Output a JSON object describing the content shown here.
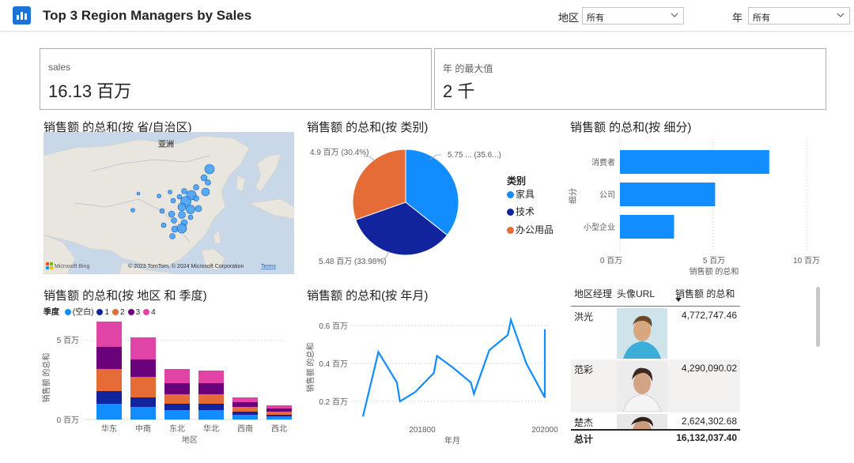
{
  "header": {
    "title": "Top 3 Region Managers by Sales",
    "region_filter_label": "地区",
    "region_filter_value": "所有",
    "year_filter_label": "年",
    "year_filter_value": "所有"
  },
  "cards": [
    {
      "label": "sales",
      "value": "16.13 百万"
    },
    {
      "label": "年 的最大值",
      "value": "2 千"
    }
  ],
  "map_visual": {
    "title": "销售额 的总和(按 省/自治区)",
    "region_label": "亚洲",
    "logo_text": "Microsoft Bing",
    "copyright": "© 2023 TomTom, © 2024 Microsoft Corporation",
    "terms": "Terms"
  },
  "pie_visual": {
    "title": "销售额 的总和(按 类别)",
    "legend_title": "类别",
    "labels": [
      "5.75 ... (35.6...)",
      "4.9 百万 (30.4%)",
      "5.48 百万 (33.98%)"
    ]
  },
  "bar_visual": {
    "title": "销售额 的总和(按 细分)",
    "ylabel": "细分",
    "xlabel": "销售额 的总和",
    "ticks": [
      "0 百万",
      "5 百万",
      "10 百万"
    ]
  },
  "stacked_visual": {
    "title": "销售额 的总和(按 地区 和 季度)",
    "legend_title": "季度",
    "ylabel": "销售额 的总和",
    "xlabel": "地区",
    "yticks": [
      "5 百万",
      "0 百万"
    ]
  },
  "line_visual": {
    "title": "销售额 的总和(按 年月)",
    "ylabel": "销售额 的总和",
    "xlabel": "年月",
    "yticks": [
      "0.6 百万",
      "0.4 百万",
      "0.2 百万"
    ],
    "xticks": [
      "201800",
      "202000"
    ]
  },
  "table": {
    "headers": [
      "地区经理",
      "头像URL",
      "销售额 的总和"
    ],
    "rows": [
      {
        "manager": "洪光",
        "sales": "4,772,747.46"
      },
      {
        "manager": "范彩",
        "sales": "4,290,090.02"
      },
      {
        "manager": "楚杰",
        "sales": "2,624,302.68"
      }
    ],
    "total_label": "总计",
    "total_value": "16,132,037.40"
  },
  "chart_data": [
    {
      "type": "pie",
      "title": "销售额 的总和(按 类别)",
      "legend_title": "类别",
      "categories": [
        "家具",
        "技术",
        "办公用品"
      ],
      "values": [
        5.75,
        5.48,
        4.9
      ],
      "unit": "百万",
      "percentages": [
        35.6,
        33.98,
        30.4
      ],
      "colors": [
        "#118dff",
        "#12239e",
        "#e66c37"
      ],
      "legend_position": "right"
    },
    {
      "type": "bar",
      "orientation": "horizontal",
      "title": "销售额 的总和(按 细分)",
      "categories": [
        "消费者",
        "公司",
        "小型企业"
      ],
      "values": [
        8.0,
        5.1,
        2.9
      ],
      "unit": "百万",
      "xlim": [
        0,
        10
      ],
      "xlabel": "销售额 的总和",
      "ylabel": "细分",
      "color": "#118dff"
    },
    {
      "type": "bar",
      "stacked": true,
      "title": "销售额 的总和(按 地区 和 季度)",
      "categories": [
        "华东",
        "中南",
        "东北",
        "华北",
        "西南",
        "西北"
      ],
      "legend_title": "季度",
      "series": [
        {
          "name": "(空白)",
          "color": "#118dff",
          "values": [
            1.0,
            0.8,
            0.6,
            0.6,
            0.3,
            0.2
          ]
        },
        {
          "name": "1",
          "color": "#12239e",
          "values": [
            0.8,
            0.6,
            0.4,
            0.4,
            0.2,
            0.1
          ]
        },
        {
          "name": "2",
          "color": "#e66c37",
          "values": [
            1.4,
            1.3,
            0.6,
            0.6,
            0.3,
            0.2
          ]
        },
        {
          "name": "3",
          "color": "#6b007b",
          "values": [
            1.4,
            1.1,
            0.7,
            0.7,
            0.3,
            0.2
          ]
        },
        {
          "name": "4",
          "color": "#e044a7",
          "values": [
            1.6,
            1.4,
            0.9,
            0.8,
            0.3,
            0.2
          ]
        }
      ],
      "unit": "百万",
      "ylim": [
        0,
        6
      ],
      "xlabel": "地区",
      "ylabel": "销售额 的总和"
    },
    {
      "type": "line",
      "title": "销售额 的总和(按 年月)",
      "x": [
        201501,
        201506,
        201512,
        201601,
        201606,
        201612,
        201701,
        201706,
        201712,
        201801,
        201806,
        201812,
        201901,
        201906,
        201912,
        202000
      ],
      "y": [
        0.12,
        0.46,
        0.3,
        0.2,
        0.25,
        0.35,
        0.44,
        0.38,
        0.3,
        0.24,
        0.47,
        0.55,
        0.63,
        0.4,
        0.22,
        0.58
      ],
      "unit": "百万",
      "ylim": [
        0.1,
        0.65
      ],
      "xlabel": "年月",
      "ylabel": "销售额 的总和",
      "color": "#118dff"
    }
  ]
}
